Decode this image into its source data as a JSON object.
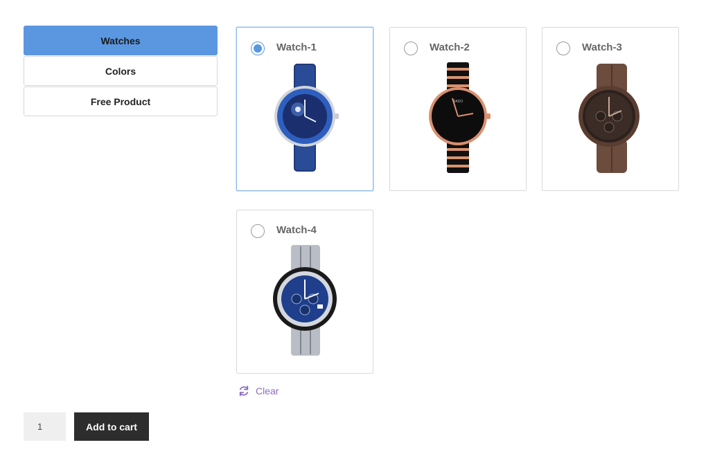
{
  "tabs": [
    {
      "label": "Watches",
      "active": true
    },
    {
      "label": "Colors",
      "active": false
    },
    {
      "label": "Free Product",
      "active": false
    }
  ],
  "products": [
    {
      "name": "Watch-1",
      "selected": true,
      "icon": "watch-1-image"
    },
    {
      "name": "Watch-2",
      "selected": false,
      "icon": "watch-2-image"
    },
    {
      "name": "Watch-3",
      "selected": false,
      "icon": "watch-3-image"
    },
    {
      "name": "Watch-4",
      "selected": false,
      "icon": "watch-4-image"
    }
  ],
  "clear": {
    "label": "Clear",
    "icon": "refresh-icon"
  },
  "cart": {
    "quantity": "1",
    "add_label": "Add to cart"
  },
  "colors": {
    "accent": "#5a97e0",
    "button": "#2d2d2d",
    "link": "#8a6cc2"
  }
}
